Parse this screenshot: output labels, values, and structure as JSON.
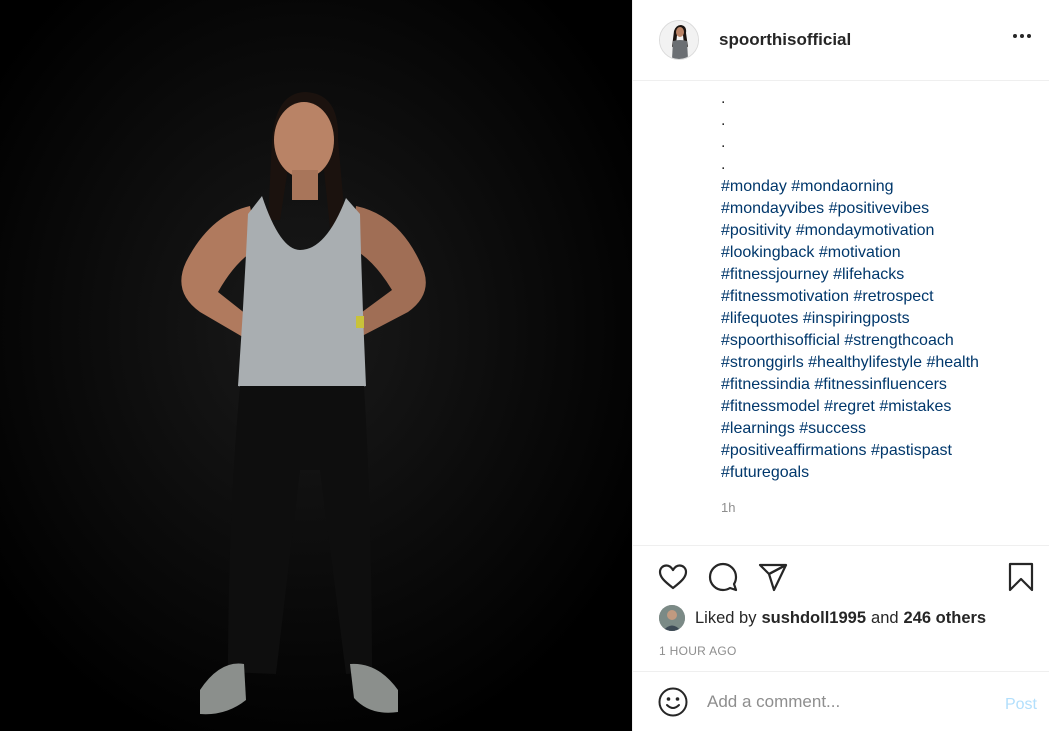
{
  "header": {
    "username": "spoorthisofficial",
    "avatar_icon": "profile-avatar",
    "more_icon": "more-options-icon"
  },
  "caption": {
    "dots": [
      ".",
      ".",
      ".",
      "."
    ],
    "hashtag_lines": [
      [
        "#monday",
        "#mondaorning"
      ],
      [
        "#mondayvibes",
        "#positivevibes"
      ],
      [
        "#positivity",
        "#mondaymotivation"
      ],
      [
        "#lookingback",
        "#motivation"
      ],
      [
        "#fitnessjourney",
        "#lifehacks"
      ],
      [
        "#fitnessmotivation",
        "#retrospect"
      ],
      [
        "#lifequotes",
        "#inspiringposts"
      ],
      [
        "#spoorthisofficial",
        "#strengthcoach"
      ],
      [
        "#stronggirls",
        "#healthylifestyle",
        "#health"
      ],
      [
        "#fitnessindia",
        "#fitnessinfluencers"
      ],
      [
        "#fitnessmodel",
        "#regret",
        "#mistakes"
      ],
      [
        "#learnings",
        "#success"
      ],
      [
        "#positiveaffirmations",
        "#pastispast"
      ],
      [
        "#futuregoals"
      ]
    ],
    "time_ago": "1h"
  },
  "actions": {
    "like_icon": "heart-icon",
    "comment_icon": "comment-icon",
    "share_icon": "share-icon",
    "save_icon": "bookmark-icon"
  },
  "likes": {
    "prefix": "Liked by",
    "user": "sushdoll1995",
    "conjunction": "and",
    "others": "246 others"
  },
  "post_time": "1 HOUR AGO",
  "comment": {
    "placeholder": "Add a comment...",
    "post_label": "Post",
    "emoji_icon": "emoji-icon"
  },
  "colors": {
    "hashtag": "#00376b",
    "muted": "#8e8e8e",
    "post_button": "#b2dffc",
    "border": "#efefef"
  }
}
